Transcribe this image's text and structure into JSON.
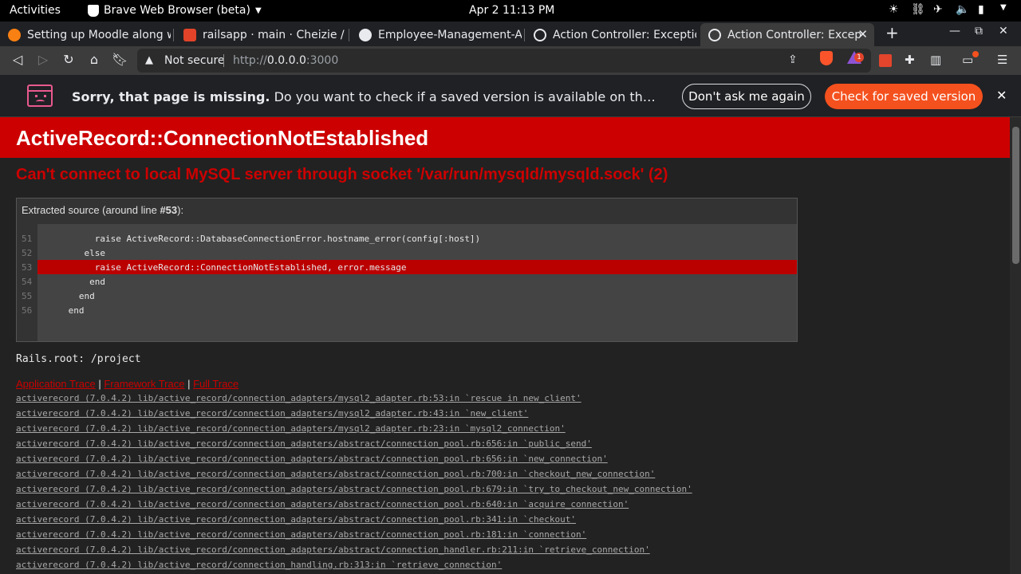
{
  "topbar": {
    "activities": "Activities",
    "app_name": "Brave Web Browser (beta)",
    "clock": "Apr 2  11:13 PM"
  },
  "tabs": [
    {
      "title": "Setting up Moodle along w",
      "icon": "moodle-icon",
      "color": "#f98012"
    },
    {
      "title": "railsapp · main · Cheizie / ta",
      "icon": "gitlab-icon",
      "color": "#e24329"
    },
    {
      "title": "Employee-Management-Ap",
      "icon": "github-icon",
      "color": "#e8eaed"
    },
    {
      "title": "Action Controller: Exceptio",
      "icon": "globe-icon",
      "color": "#e8eaed"
    },
    {
      "title": "Action Controller: Excep",
      "icon": "globe-icon",
      "color": "#e8eaed",
      "active": true
    }
  ],
  "address_bar": {
    "security": "Not secure",
    "url_scheme": "http://",
    "url_host": "0.0.0.0",
    "url_port": ":3000"
  },
  "rewards_badge": "1",
  "infobar": {
    "bold": "Sorry, that page is missing.",
    "text": " Do you want to check if a saved version is available on the Wayback Machine?",
    "dismiss_label": "Don't ask me again",
    "action_label": "Check for saved version"
  },
  "error": {
    "title": "ActiveRecord::ConnectionNotEstablished",
    "message": "Can't connect to local MySQL server through socket '/var/run/mysqld/mysqld.sock' (2)",
    "source_header_prefix": "Extracted source (around line ",
    "source_line": "#53",
    "source_header_suffix": "):",
    "source": [
      {
        "n": "51",
        "code": "      raise ActiveRecord::DatabaseConnectionError.hostname_error(config[:host])"
      },
      {
        "n": "52",
        "code": "    else"
      },
      {
        "n": "53",
        "code": "      raise ActiveRecord::ConnectionNotEstablished, error.message",
        "highlight": true
      },
      {
        "n": "54",
        "code": "     end"
      },
      {
        "n": "55",
        "code": "   end"
      },
      {
        "n": "56",
        "code": " end"
      }
    ],
    "rails_root": "Rails.root: /project",
    "trace_tabs": [
      "Application Trace",
      "Framework Trace",
      "Full Trace"
    ],
    "trace": [
      "activerecord (7.0.4.2) lib/active_record/connection_adapters/mysql2_adapter.rb:53:in `rescue in new_client'",
      "activerecord (7.0.4.2) lib/active_record/connection_adapters/mysql2_adapter.rb:43:in `new_client'",
      "activerecord (7.0.4.2) lib/active_record/connection_adapters/mysql2_adapter.rb:23:in `mysql2_connection'",
      "activerecord (7.0.4.2) lib/active_record/connection_adapters/abstract/connection_pool.rb:656:in `public_send'",
      "activerecord (7.0.4.2) lib/active_record/connection_adapters/abstract/connection_pool.rb:656:in `new_connection'",
      "activerecord (7.0.4.2) lib/active_record/connection_adapters/abstract/connection_pool.rb:700:in `checkout_new_connection'",
      "activerecord (7.0.4.2) lib/active_record/connection_adapters/abstract/connection_pool.rb:679:in `try_to_checkout_new_connection'",
      "activerecord (7.0.4.2) lib/active_record/connection_adapters/abstract/connection_pool.rb:640:in `acquire_connection'",
      "activerecord (7.0.4.2) lib/active_record/connection_adapters/abstract/connection_pool.rb:341:in `checkout'",
      "activerecord (7.0.4.2) lib/active_record/connection_adapters/abstract/connection_pool.rb:181:in `connection'",
      "activerecord (7.0.4.2) lib/active_record/connection_adapters/abstract/connection_handler.rb:211:in `retrieve_connection'",
      "activerecord (7.0.4.2) lib/active_record/connection_handling.rb:313:in `retrieve_connection'"
    ]
  },
  "colors": {
    "error_red": "#cc0000",
    "brave_orange": "#f4511e"
  }
}
